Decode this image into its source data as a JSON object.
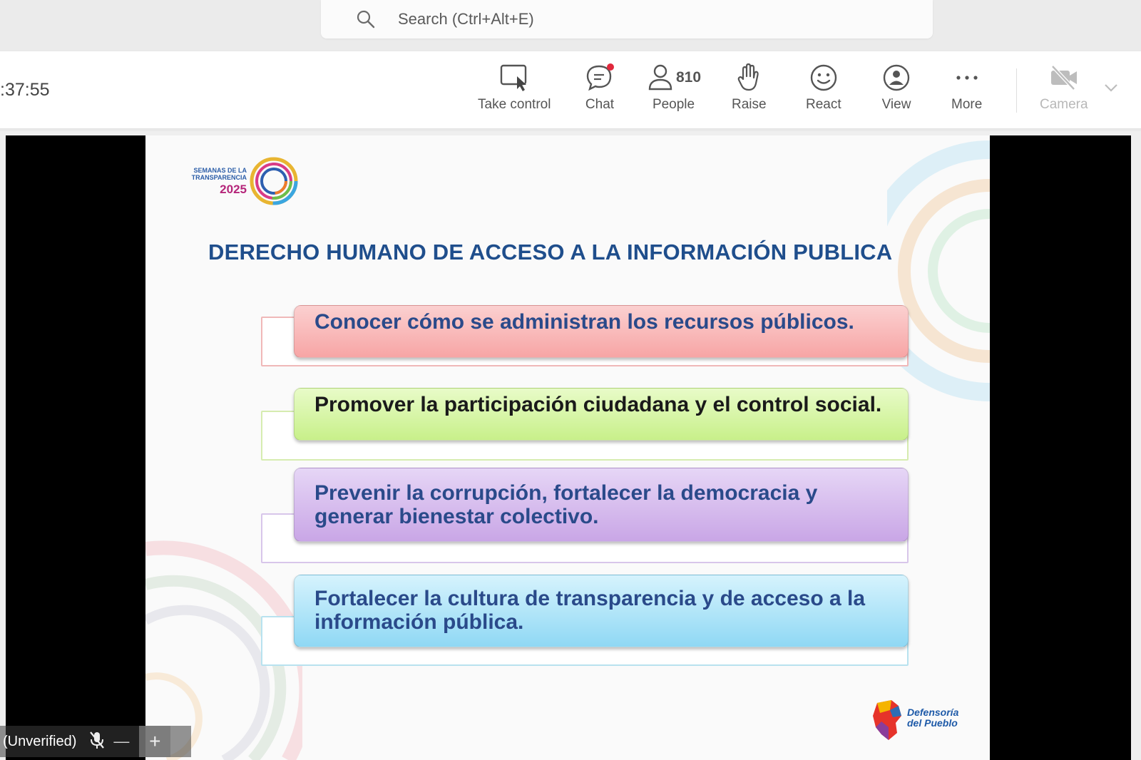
{
  "search": {
    "placeholder": "Search (Ctrl+Alt+E)"
  },
  "meeting": {
    "timer": ":37:55",
    "toolbar": {
      "take_control": "Take control",
      "chat": "Chat",
      "people": "People",
      "people_count": "810",
      "raise": "Raise",
      "react": "React",
      "view": "View",
      "more": "More",
      "camera": "Camera"
    }
  },
  "slide": {
    "logo_left": {
      "line1": "SEMANAS DE LA",
      "line2": "TRANSPARENCIA",
      "year": "2025"
    },
    "title": "DERECHO HUMANO DE ACCESO A LA INFORMACIÓN PUBLICA",
    "items": [
      {
        "text": "Conocer cómo se administran los recursos públicos.",
        "fill": "#f7a5a5",
        "fill2": "#fbd0d0",
        "text_color": "#2a4a8a",
        "border": "#f0b8b8"
      },
      {
        "text": "Promover la participación ciudadana y el control social.",
        "fill": "#c8f08a",
        "fill2": "#e8fbc8",
        "text_color": "#1a1a1a",
        "border": "#d6ecb0"
      },
      {
        "text": "Prevenir la corrupción, fortalecer la democracia y generar bienestar colectivo.",
        "fill": "#c9a6e6",
        "fill2": "#e6d6f6",
        "text_color": "#2a4a8a",
        "border": "#d8c6ea"
      },
      {
        "text": "Fortalecer la cultura de transparencia y de acceso a la información pública.",
        "fill": "#8fd8f4",
        "fill2": "#d6f3fd",
        "text_color": "#2a4a8a",
        "border": "#b8e2ef"
      }
    ],
    "logo_right": {
      "line1": "Defensoría",
      "line2": "del Pueblo"
    }
  },
  "participant": {
    "name": "(Unverified)"
  }
}
